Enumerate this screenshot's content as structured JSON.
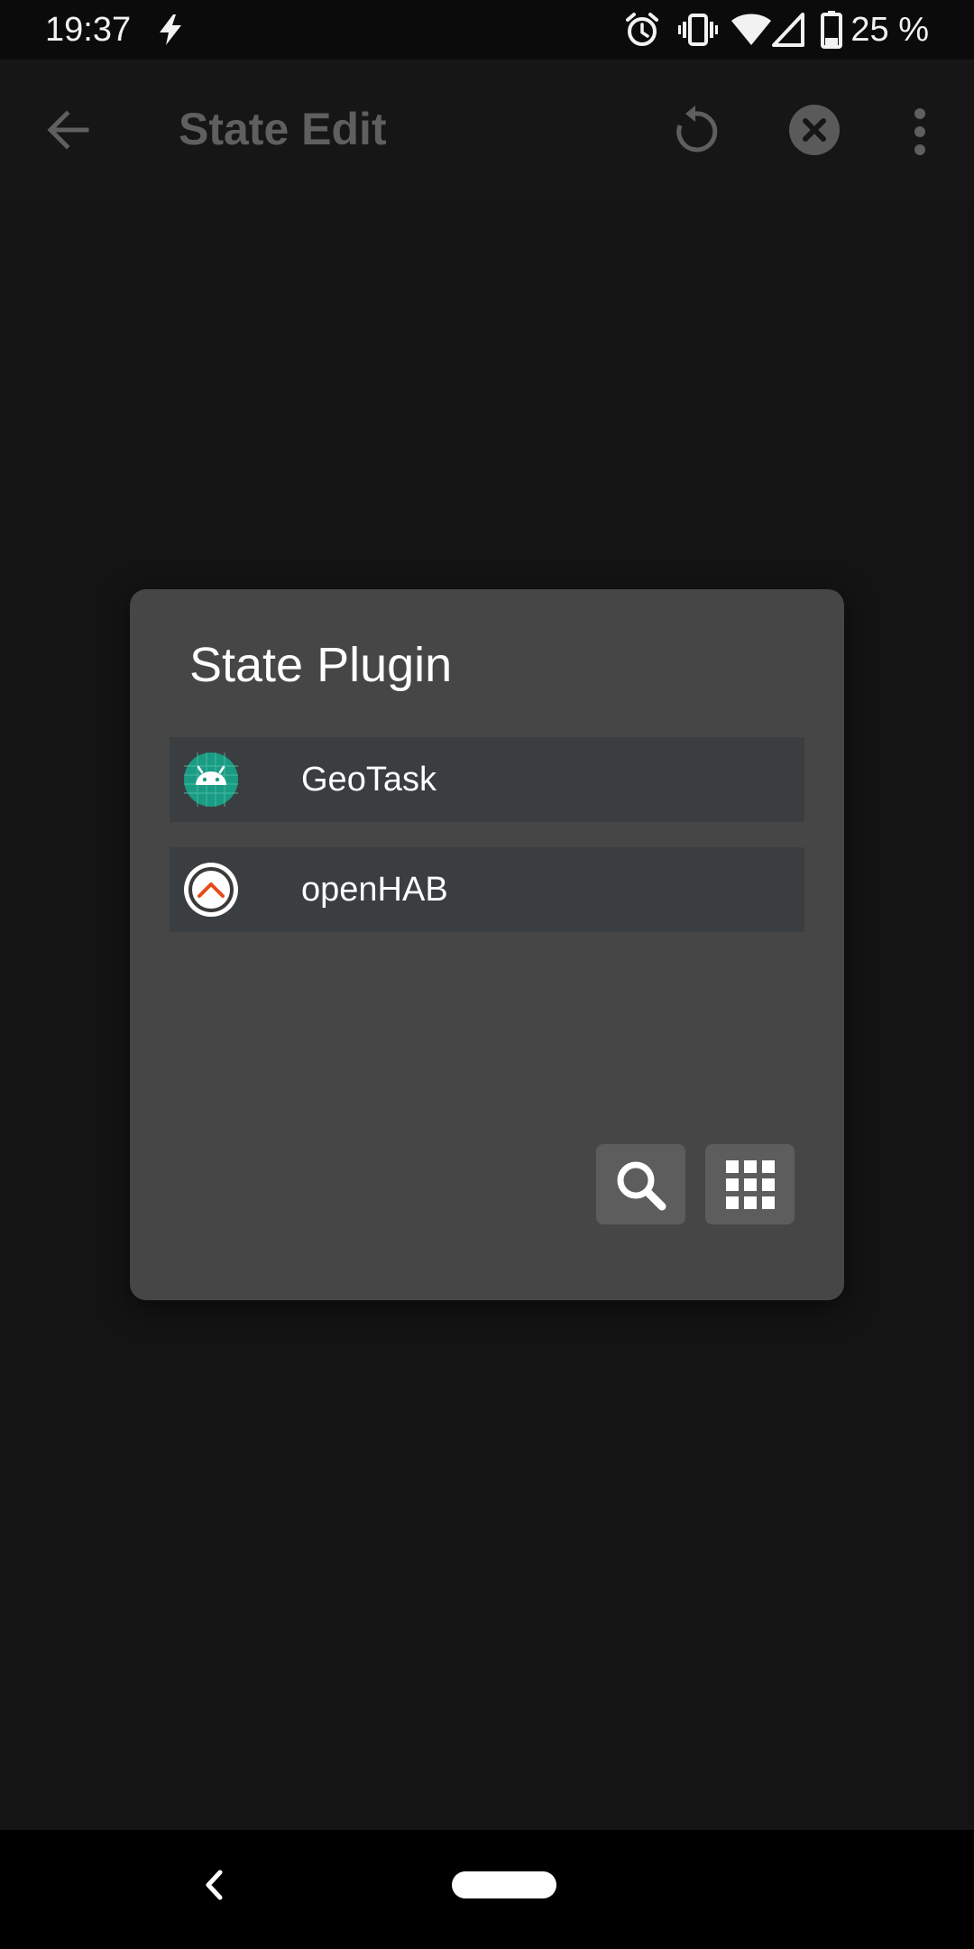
{
  "status_bar": {
    "time": "19:37",
    "battery_text": "25 %",
    "icons": [
      "flash-icon",
      "alarm-icon",
      "vibrate-icon",
      "wifi-icon",
      "signal-icon",
      "battery-icon"
    ]
  },
  "app_bar": {
    "title": "State Edit",
    "icons": [
      "back-arrow-icon",
      "reset-icon",
      "close-icon",
      "more-vert-icon"
    ]
  },
  "dialog": {
    "title": "State Plugin",
    "items": [
      {
        "label": "GeoTask",
        "icon": "android-icon"
      },
      {
        "label": "openHAB",
        "icon": "openhab-icon"
      }
    ],
    "buttons": [
      "search-icon",
      "grid-icon"
    ]
  },
  "nav_bar": {
    "icons": [
      "nav-back-icon",
      "home-pill-icon"
    ]
  },
  "colors": {
    "background": "#141414",
    "dialog": "#464646",
    "item": "#3b3e41",
    "button": "#5d5d5d",
    "android_green": "#1a9b84",
    "openhab_orange": "#e64a19"
  }
}
